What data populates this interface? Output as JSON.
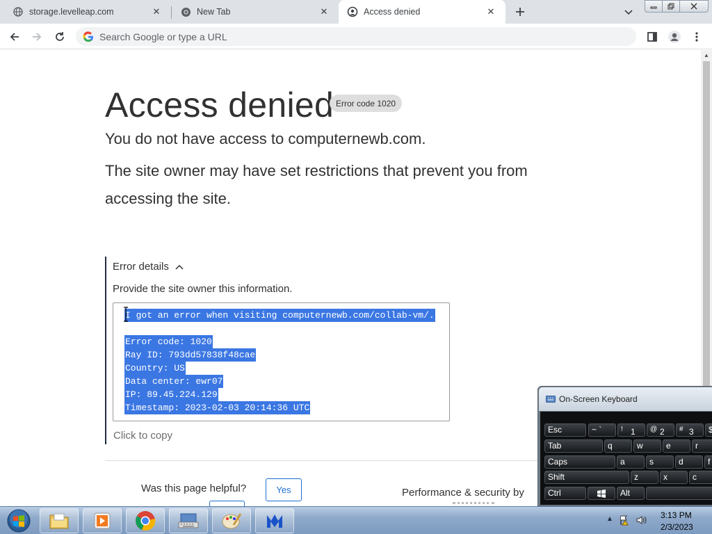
{
  "browser": {
    "tabs": [
      {
        "title": "storage.levelleap.com",
        "favicon": "globe-icon",
        "active": false
      },
      {
        "title": "New Tab",
        "favicon": "chrome-icon",
        "active": false
      },
      {
        "title": "Access denied",
        "favicon": "cloudflare-icon",
        "active": true
      }
    ],
    "omnibox_placeholder": "Search Google or type a URL"
  },
  "page": {
    "title": "Access denied",
    "error_code_badge": "Error code 1020",
    "subtitle": "You do not have access to computernewb.com.",
    "explanation": "The site owner may have set restrictions that prevent you from accessing the site.",
    "details": {
      "toggle_label": "Error details",
      "intro": "Provide the site owner this information.",
      "lines": [
        "I got an error when visiting computernewb.com/collab-vm/.",
        "",
        "Error code: 1020",
        "Ray ID: 793dd57838f48cae",
        "Country: US",
        "Data center: ewr07",
        "IP: 89.45.224.129",
        "Timestamp: 2023-02-03 20:14:36 UTC"
      ],
      "copy_label": "Click to copy"
    },
    "feedback": {
      "question": "Was this page helpful?",
      "yes_label": "Yes"
    },
    "footer_text": "Performance & security by"
  },
  "osk": {
    "title": "On-Screen Keyboard",
    "rows": [
      [
        {
          "label": "Esc"
        },
        {
          "label": "~ `"
        },
        {
          "top": "!",
          "bottom": "1"
        },
        {
          "top": "@",
          "bottom": "2"
        },
        {
          "top": "#",
          "bottom": "3"
        },
        {
          "label": "$"
        }
      ],
      [
        {
          "label": "Tab"
        },
        {
          "label": "q"
        },
        {
          "label": "w"
        },
        {
          "label": "e"
        },
        {
          "label": "r"
        }
      ],
      [
        {
          "label": "Caps"
        },
        {
          "label": "a"
        },
        {
          "label": "s"
        },
        {
          "label": "d"
        },
        {
          "label": "f"
        }
      ],
      [
        {
          "label": "Shift"
        },
        {
          "label": "z"
        },
        {
          "label": "x"
        },
        {
          "label": "c"
        }
      ],
      [
        {
          "label": "Ctrl"
        },
        {
          "label": ""
        },
        {
          "label": "Alt"
        },
        {
          "label": ""
        }
      ]
    ]
  },
  "taskbar": {
    "apps": [
      "explorer-icon",
      "media-player-icon",
      "chrome-icon",
      "osk-icon",
      "paint-icon",
      "malwarebytes-icon"
    ],
    "time": "3:13 PM",
    "date": "2/3/2023"
  },
  "colors": {
    "selection": "#3b77e3",
    "link_blue": "#1f6fd1",
    "tab_strip": "#dee1e6"
  }
}
